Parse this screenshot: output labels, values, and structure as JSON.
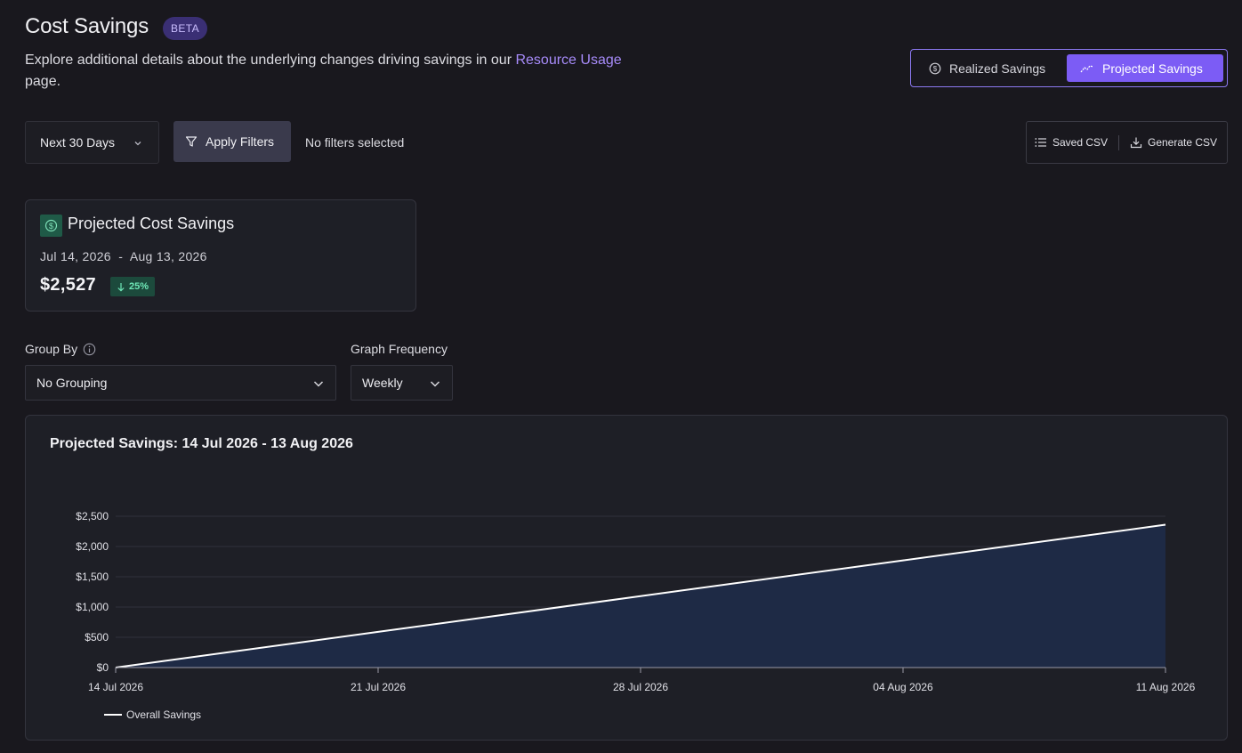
{
  "header": {
    "title": "Cost Savings",
    "badge": "BETA",
    "subtitle_prefix": "Explore additional details about the underlying changes driving savings in our ",
    "subtitle_link": "Resource Usage",
    "subtitle_suffix": " page."
  },
  "view_toggle": {
    "realized_label": "Realized Savings",
    "projected_label": "Projected Savings",
    "active": "projected"
  },
  "filters": {
    "date_range": "Next 30 Days",
    "apply_label": "Apply Filters",
    "status": "No filters selected"
  },
  "csv": {
    "saved_label": "Saved CSV",
    "generate_label": "Generate CSV"
  },
  "summary_card": {
    "title": "Projected Cost Savings",
    "date_range": "Jul 14, 2026  -  Aug 13, 2026",
    "value": "$2,527",
    "change": "25%",
    "change_direction": "down"
  },
  "group_by": {
    "label": "Group By",
    "value": "No Grouping"
  },
  "graph_frequency": {
    "label": "Graph Frequency",
    "value": "Weekly"
  },
  "chart": {
    "title": "Projected Savings: 14 Jul 2026 - 13 Aug 2026"
  },
  "colors": {
    "accent": "#7c5cf5",
    "area_fill": "#1e2a45",
    "line": "#ffffff",
    "positive_badge": "#6ee7b7"
  },
  "chart_data": {
    "type": "area",
    "x": [
      "14 Jul 2026",
      "21 Jul 2026",
      "28 Jul 2026",
      "04 Aug 2026",
      "11 Aug 2026"
    ],
    "series": [
      {
        "name": "Overall Savings",
        "values": [
          0,
          590,
          1180,
          1770,
          2360
        ]
      }
    ],
    "y_ticks": [
      "$0",
      "$500",
      "$1,000",
      "$1,500",
      "$2,000",
      "$2,500"
    ],
    "y_tick_values": [
      0,
      500,
      1000,
      1500,
      2000,
      2500
    ],
    "ylim": [
      0,
      2500
    ],
    "grid": true,
    "legend_position": "bottom-left"
  }
}
